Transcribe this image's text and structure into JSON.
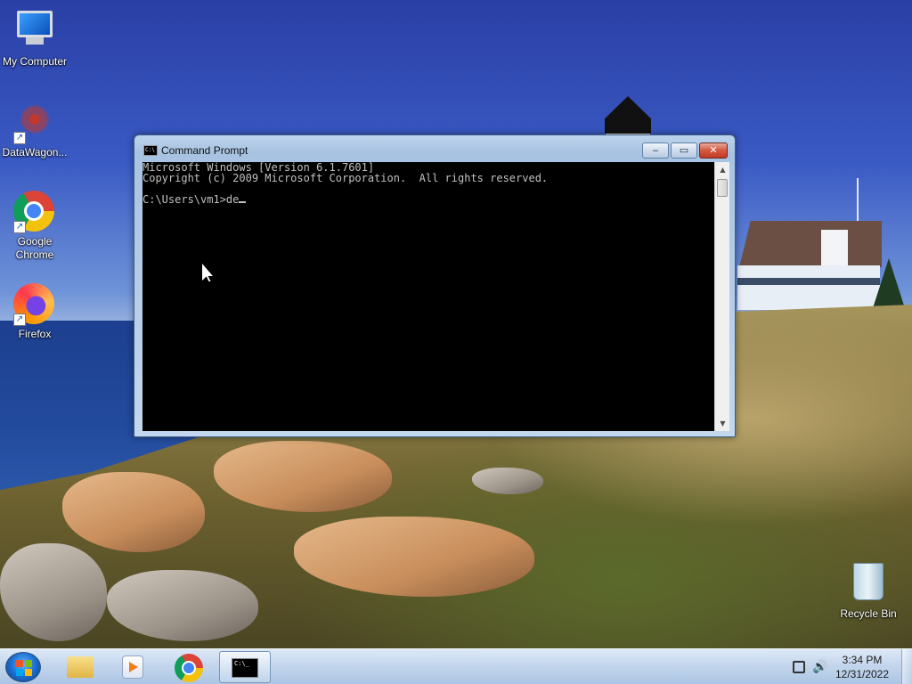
{
  "desktop": {
    "icons": [
      {
        "label": "My Computer",
        "icon": "computer-icon"
      },
      {
        "label": "DataWagon...",
        "icon": "datawagon-icon"
      },
      {
        "label": "Google Chrome",
        "icon": "chrome-icon"
      },
      {
        "label": "Firefox",
        "icon": "firefox-icon"
      },
      {
        "label": "Recycle Bin",
        "icon": "recycle-bin-icon"
      }
    ]
  },
  "window": {
    "title": "Command Prompt",
    "buttons": {
      "minimize": "‒",
      "maximize": "▭",
      "close": "✕"
    },
    "console": {
      "lines": [
        "Microsoft Windows [Version 6.1.7601]",
        "Copyright (c) 2009 Microsoft Corporation.  All rights reserved.",
        "",
        "C:\\Users\\vm1>de"
      ]
    }
  },
  "taskbar": {
    "clock": {
      "time": "3:34 PM",
      "date": "12/31/2022"
    },
    "pinned": [
      "windows-explorer-icon",
      "media-player-icon",
      "chrome-icon",
      "command-prompt-icon"
    ],
    "active": "command-prompt-icon"
  },
  "colors": {
    "console_bg": "#000000",
    "console_fg": "#c0c0c0",
    "close_button": "#c94c34"
  }
}
